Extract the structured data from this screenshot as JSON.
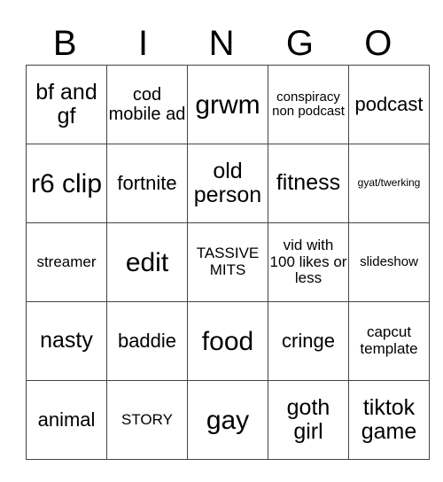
{
  "header": [
    "B",
    "I",
    "N",
    "G",
    "O"
  ],
  "rows": [
    [
      "bf and gf",
      "cod mobile ad",
      "grwm",
      "conspiracy non podcast",
      "podcast"
    ],
    [
      "r6 clip",
      "fortnite",
      "old person",
      "fitness",
      "gyat/twerking"
    ],
    [
      "streamer",
      "edit",
      "TASSIVE MITS",
      "vid with 100 likes or less",
      "slideshow"
    ],
    [
      "nasty",
      "baddie",
      "food",
      "cringe",
      "capcut template"
    ],
    [
      "animal",
      "STORY",
      "gay",
      "goth girl",
      "tiktok game"
    ]
  ]
}
